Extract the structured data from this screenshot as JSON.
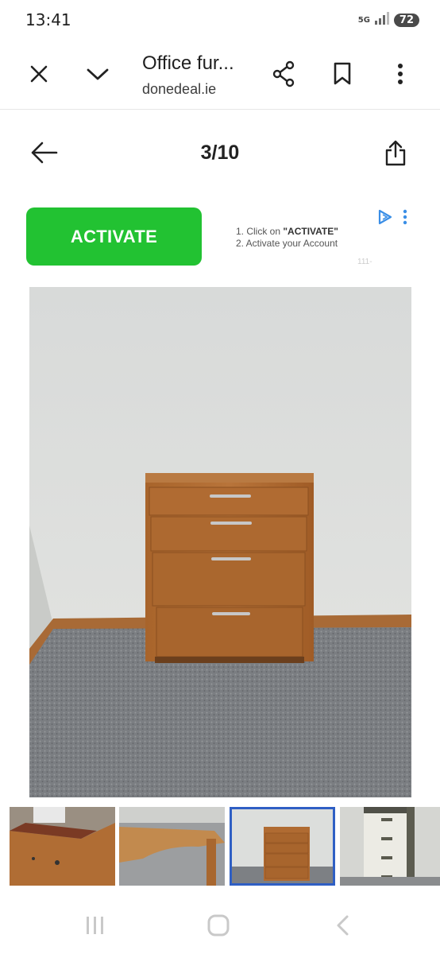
{
  "status_bar": {
    "time": "13:41",
    "network": "5G",
    "battery": "72",
    "icons": [
      "signal-icon",
      "battery-icon"
    ]
  },
  "toolbar": {
    "title": "Office fur...",
    "url": "donedeal.ie",
    "icons": [
      "close-icon",
      "chevron-down-icon",
      "share-icon",
      "bookmark-icon",
      "more-vert-icon"
    ]
  },
  "gallery": {
    "counter": "3/10",
    "icons": [
      "back-arrow-icon",
      "share-upload-icon"
    ]
  },
  "ad": {
    "button_label": "ACTIVATE",
    "step1_prefix": "1. Click on ",
    "step1_bold": "\"ACTIVATE\"",
    "step2": "2. Activate your Account",
    "faint": "111-",
    "accent": "#22c232"
  },
  "thumbnails": {
    "active_index": 2,
    "active_color": "#2f5fc4",
    "count_visible": 4
  },
  "navbar": {
    "icons": [
      "recent-apps-icon",
      "home-icon",
      "back-icon"
    ]
  }
}
